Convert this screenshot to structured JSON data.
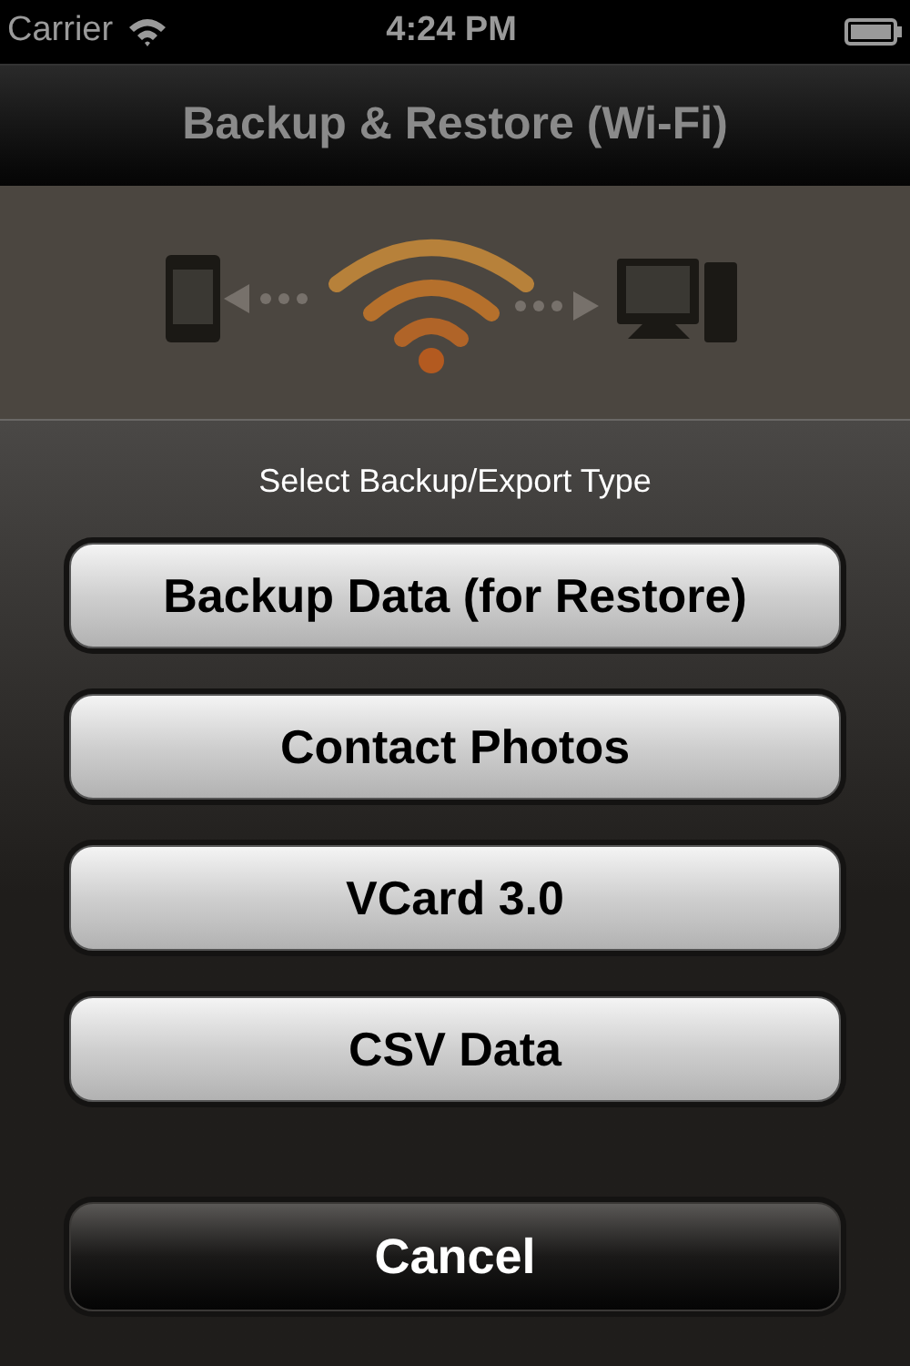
{
  "status_bar": {
    "carrier": "Carrier",
    "time": "4:24 PM"
  },
  "nav_bar": {
    "title": "Backup & Restore (Wi-Fi)"
  },
  "action_sheet": {
    "title": "Select Backup/Export Type",
    "buttons": [
      {
        "label": "Backup Data (for Restore)",
        "kind": "option"
      },
      {
        "label": "Contact Photos",
        "kind": "option"
      },
      {
        "label": "VCard 3.0",
        "kind": "option"
      },
      {
        "label": "CSV Data",
        "kind": "option"
      },
      {
        "label": "Cancel",
        "kind": "cancel"
      }
    ]
  }
}
